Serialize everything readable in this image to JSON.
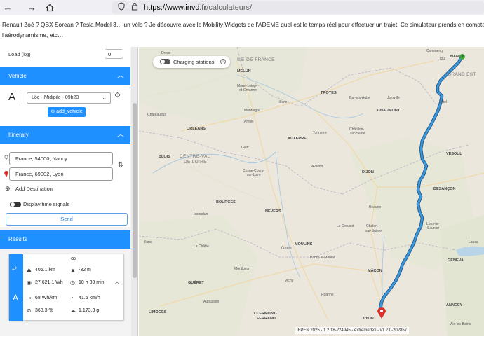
{
  "browser": {
    "url_host": "https://www.invd.fr",
    "url_path": "/calculateurs/"
  },
  "intro": {
    "line1": "Renault Zoé ? QBX Sorean ? Tesla Model 3… un vélo ? Je découvre avec le Mobility Widgets de l'ADEME quel est le temps réel pour effectuer un trajet. Ce simulateur prends en compte",
    "line2": "l'aérodynamisme, etc…"
  },
  "panel": {
    "load_label": "Load (kg)",
    "load_value": "0",
    "vehicle_header": "Vehicle",
    "vehicle_select": "Lõe - Midipile - 09h23",
    "add_vehicle": "add_vehicle",
    "itinerary_header": "Itinerary",
    "origin": "France, 54000, Nancy",
    "destination": "France, 69002, Lyon",
    "add_destination": "Add Destination",
    "time_signals": "Display time signals",
    "send": "Send",
    "results_header": "Results"
  },
  "results": {
    "distance": "406.1 km",
    "elevation": "-32 m",
    "energy": "27,621.1 Wh",
    "duration": "10 h 39 min",
    "consumption": "68 Wh/km",
    "speed": "41.6 km/h",
    "percent": "368.3 %",
    "co2": "1,173.3 g"
  },
  "map": {
    "charging_stations": "Charging stations",
    "attribution": "IFPEN 2025 - 1.2.18-224945 - extremedefi - v1.2.0-202857",
    "route_color": "#3a9ad9",
    "origin_marker_color": "#3aa83a",
    "destination_marker_color": "#d9302c",
    "regions": {
      "ile_de_france": "ILE-DE-FRANCE",
      "grand_est": "GRAND EST",
      "centre_val_de_loire_1": "CENTRE-VAL",
      "centre_val_de_loire_2": "DE LOIRE"
    },
    "towns": {
      "dreux": "Dreux",
      "melun": "MELUN",
      "moret": "Moret-Loing-",
      "moret2": "et-Orvanne",
      "troyes": "TROYES",
      "bar_sur_aube": "Bar-sur-Aube",
      "joinville": "Joinville",
      "commercy": "Commercy",
      "toul": "Toul",
      "nancy": "NANCY",
      "sens": "Sens",
      "chaumont": "CHAUMONT",
      "vittel": "Vittel",
      "chateaudun": "Châteaudun",
      "orleans": "ORLÉANS",
      "montargis": "Montargis",
      "amilly": "Amilly",
      "auxerre": "AUXERRE",
      "tonnerre": "Tonnerre",
      "chatillon": "Châtillon-",
      "chatillon2": "sur-Seine",
      "vesoul": "VESOUL",
      "blois": "BLOIS",
      "gien": "Gien",
      "cosne": "Cosne-Cours-",
      "cosne2": "sur-Loire",
      "avallon": "Avallon",
      "dijon": "DIJON",
      "besancon": "BESANÇON",
      "bourges": "BOURGES",
      "nevers": "NEVERS",
      "beaune": "Beaune",
      "issoudun": "Issoudun",
      "le_creusot": "Le Creusot",
      "chalon": "Chalon-",
      "chalon2": "sur-Saône",
      "lons": "Lons-le-",
      "lons2": "Saunier",
      "ilanc": "Ilanc",
      "la_chatre": "La Châtre",
      "yzeure": "Yzeure",
      "moulins": "MOULINS",
      "paray": "Paray-le-Monial",
      "montlucon": "Montluçon",
      "macon": "MÂCON",
      "gueret": "GUÉRET",
      "vichy": "Vichy",
      "roanne": "Roanne",
      "geneva": "GENEVA",
      "annecy": "ANNECY",
      "aubusson": "Aubusson",
      "limoges": "LIMOGES",
      "clermont": "CLERMONT-",
      "clermont2": "FERRAND",
      "lyon": "LYON",
      "aix": "Aix-les-Bains",
      "lausanne": "Lausa"
    }
  }
}
